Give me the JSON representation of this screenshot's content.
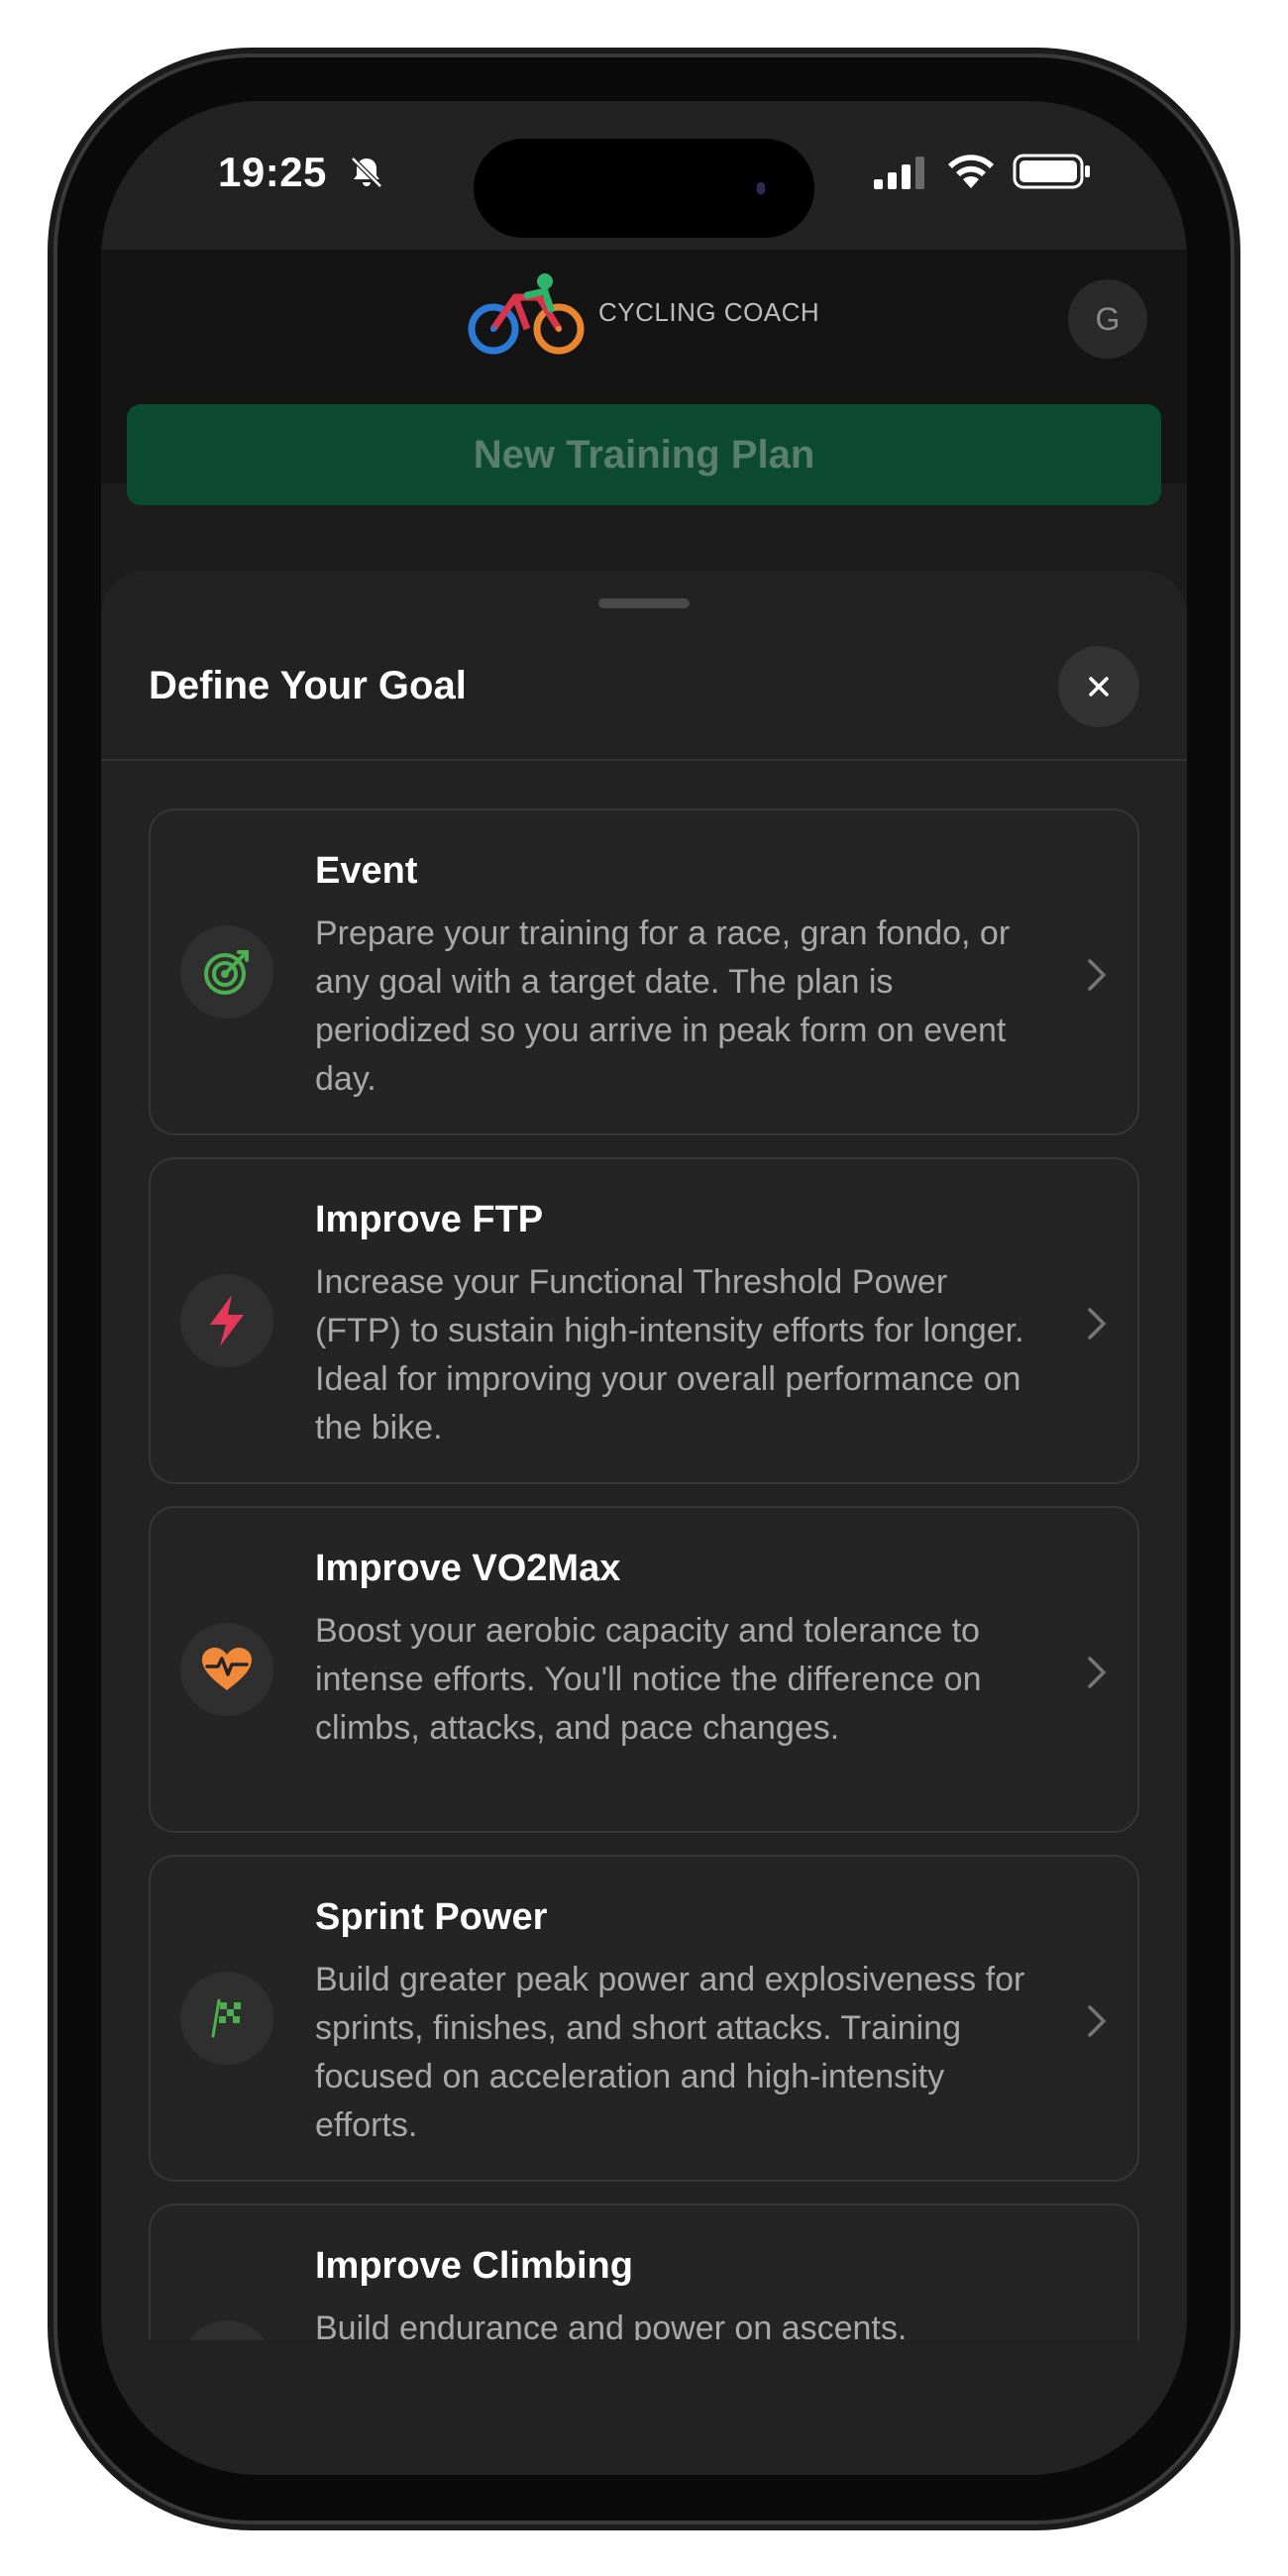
{
  "status_bar": {
    "time": "19:25",
    "icons": [
      "bell-slash-icon",
      "cellular-signal-icon",
      "wifi-icon",
      "battery-icon"
    ]
  },
  "header": {
    "logo_text": "CYCLING COACH",
    "logo_icon": "cyclist-logo-icon",
    "avatar_initial": "G"
  },
  "new_plan_button": {
    "label": "New Training Plan"
  },
  "sheet": {
    "title": "Define Your Goal",
    "close_icon": "close-icon",
    "goals": [
      {
        "title": "Event",
        "description": "Prepare your training for a race, gran fondo, or any goal with a target date. The plan is periodized so you arrive in peak form on event day.",
        "icon": "target-icon",
        "icon_color": "#4caf50"
      },
      {
        "title": "Improve FTP",
        "description": "Increase your Functional Threshold Power (FTP) to sustain high-intensity efforts for longer. Ideal for improving your overall performance on the bike.",
        "icon": "lightning-bolt-icon",
        "icon_color": "#e5395a"
      },
      {
        "title": "Improve VO2Max",
        "description": "Boost your aerobic capacity and tolerance to intense efforts. You'll notice the difference on climbs, attacks, and pace changes.",
        "icon": "heart-pulse-icon",
        "icon_color": "#f08a3a"
      },
      {
        "title": "Sprint Power",
        "description": "Build greater peak power and explosiveness for sprints, finishes, and short attacks. Training focused on acceleration and high-intensity efforts.",
        "icon": "checkered-flag-icon",
        "icon_color": "#4caf50"
      },
      {
        "title": "Improve Climbing",
        "description": "Build endurance and power on ascents.",
        "icon": "mountain-icon",
        "icon_color": "#8a8a8a"
      }
    ]
  },
  "colors": {
    "accent_green": "#0c4a34",
    "sheet_bg": "#222222",
    "card_border": "#363636"
  }
}
